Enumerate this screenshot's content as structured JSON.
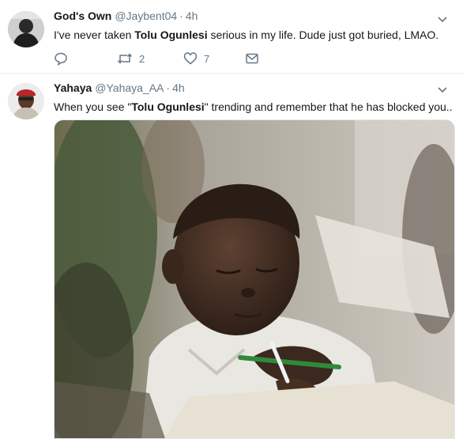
{
  "tweets": [
    {
      "display_name": "God's Own",
      "handle": "@Jaybent04",
      "separator": "·",
      "time": "4h",
      "text_parts": [
        "I've never taken ",
        "Tolu Ogunlesi",
        " serious in my life. Dude just got buried, LMAO."
      ],
      "reply_icon": "reply-icon",
      "retweet_icon": "retweet-icon",
      "like_icon": "heart-icon",
      "dm_icon": "envelope-icon",
      "retweet_count": "2",
      "like_count": "7"
    },
    {
      "display_name": "Yahaya",
      "handle": "@Yahaya_AA",
      "separator": "·",
      "time": "4h",
      "text_parts": [
        "When you see \"",
        "Tolu Ogunlesi",
        "\" trending and remember that he has blocked you.."
      ],
      "media": "photo of a young child writing at a desk"
    }
  ],
  "colors": {
    "text": "#14171a",
    "secondary": "#657786",
    "border": "#e6ecf0"
  }
}
